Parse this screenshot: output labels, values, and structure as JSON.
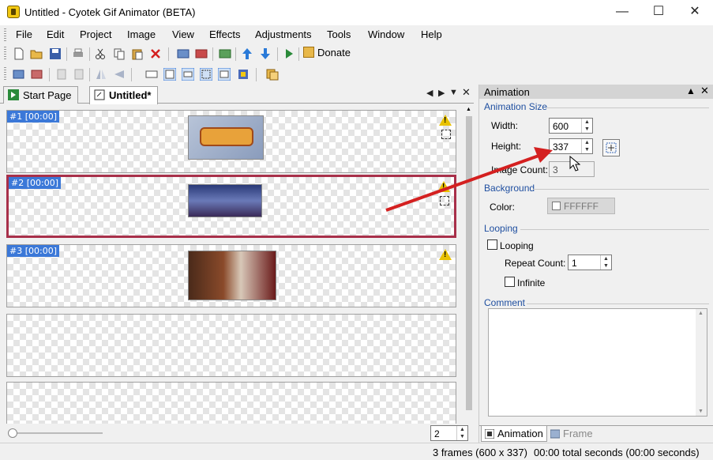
{
  "window": {
    "title": "Untitled - Cyotek Gif Animator (BETA)"
  },
  "menu": [
    "File",
    "Edit",
    "Project",
    "Image",
    "View",
    "Effects",
    "Adjustments",
    "Tools",
    "Window",
    "Help"
  ],
  "toolbar": {
    "donate_label": "Donate"
  },
  "tabs": {
    "start_page": "Start Page",
    "untitled": "Untitled*"
  },
  "frames": [
    {
      "label": "#1 [00:00]",
      "warning": true
    },
    {
      "label": "#2 [00:00]",
      "warning": true
    },
    {
      "label": "#3 [00:00]",
      "warning": true
    },
    {
      "label": "",
      "warning": false
    },
    {
      "label": "",
      "warning": false
    }
  ],
  "zoom": {
    "value": "2"
  },
  "panel": {
    "title": "Animation",
    "animation_size": {
      "header": "Animation Size",
      "width_label": "Width:",
      "width_value": "600",
      "height_label": "Height:",
      "height_value": "337",
      "image_count_label": "Image Count:",
      "image_count_value": "3"
    },
    "background": {
      "header": "Background",
      "color_label": "Color:",
      "color_value": "FFFFFF"
    },
    "looping": {
      "header": "Looping",
      "looping_label": "Looping",
      "repeat_label": "Repeat Count:",
      "repeat_value": "1",
      "infinite_label": "Infinite"
    },
    "comment": {
      "header": "Comment",
      "value": ""
    },
    "tabs": {
      "animation": "Animation",
      "frame": "Frame"
    }
  },
  "status": {
    "frames": "3 frames (600 x 337)",
    "duration": "00:00 total seconds (00:00 seconds)"
  },
  "colors": {
    "selected_frame": "#a8304a",
    "frame_label_bg": "#3b78d8",
    "section_header": "#1f4fa0",
    "annotation_arrow": "#d42020"
  }
}
